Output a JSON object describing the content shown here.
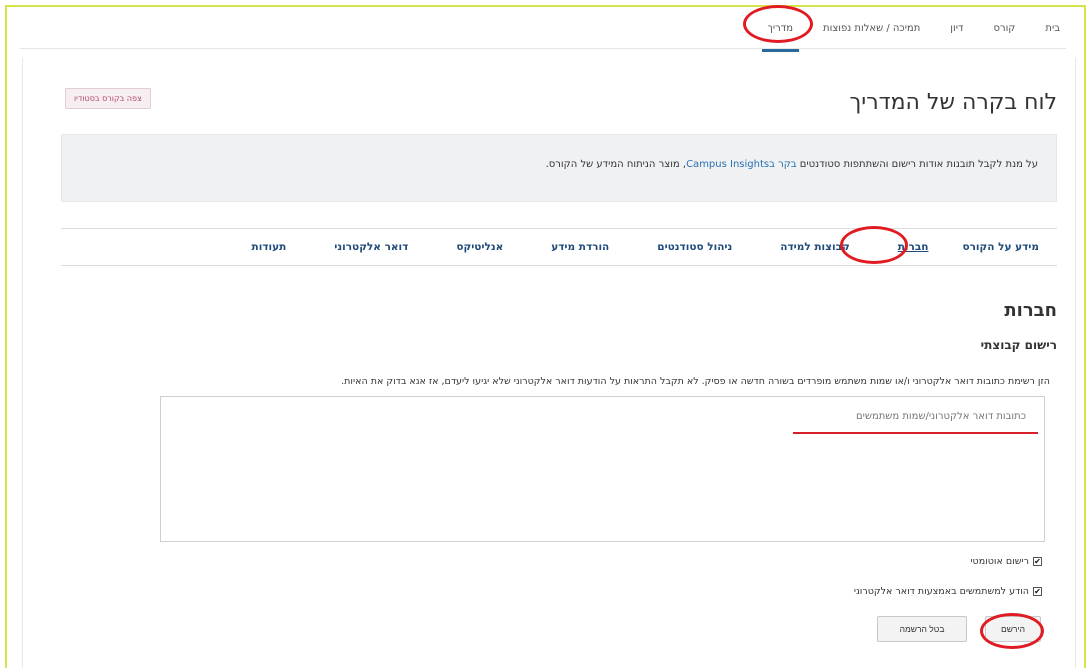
{
  "topnav": {
    "items": [
      "בית",
      "קורס",
      "דיון",
      "תמיכה / שאלות נפוצות",
      "מדריך"
    ],
    "active_index": 4
  },
  "header": {
    "title": "לוח בקרה של המדריך",
    "view_studio_label": "צפה בקורס בסטודיו"
  },
  "insights": {
    "text_before": "על מנת לקבל תובנות אודות רישום והשתתפות סטודנטים ",
    "link_text": "בקר בCampus Insights",
    "text_after": ", מוצר הניתוח המידע של הקורס."
  },
  "tabs": [
    "מידע על הקורס",
    "חברות",
    "קבוצות למידה",
    "ניהול סטודנטים",
    "הורדת מידע",
    "אנליטיקס",
    "דואר אלקטרוני",
    "תעודות"
  ],
  "active_tab_index": 1,
  "membership": {
    "section_title": "חברות",
    "subtitle": "רישום קבוצתי",
    "instructions": "הזן רשימת כתובות דואר אלקטרוני ו/או שמות משתמש מופרדים בשורה חדשה או פסיק. לא תקבל התראות על הודעות דואר אלקטרוני שלא יגיעו ליעדם, אז אנא בדוק את האיות.",
    "textarea_placeholder": "כתובות דואר אלקטרוני/שמות משתמשים",
    "auto_enroll_label": "רישום אוטומטי",
    "notify_label": "הודע למשתמשים באמצעות דואר אלקטרוני",
    "enroll_button": "הירשם",
    "unenroll_button": "בטל הרשמה"
  },
  "colors": {
    "annotation_red": "#e11b22",
    "link_blue": "#2a6fb0",
    "tab_blue": "#1f4a7a",
    "frame_yellow": "#d7e34a"
  }
}
